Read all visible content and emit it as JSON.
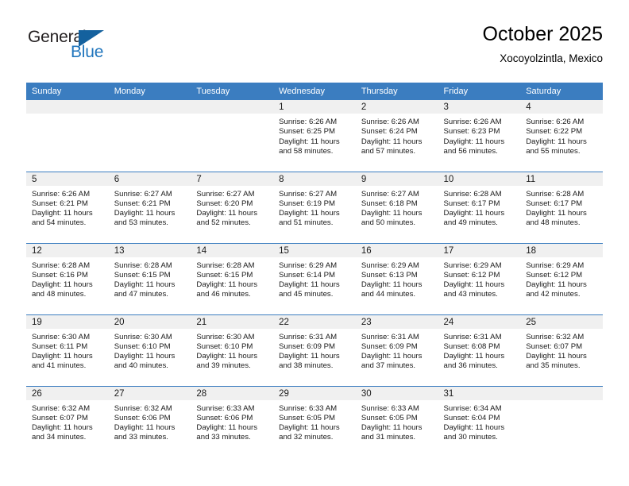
{
  "logo": {
    "word1": "General",
    "word2": "Blue",
    "triangle_color": "#14619e",
    "blue_color": "#2176bd"
  },
  "header": {
    "title": "October 2025",
    "subtitle": "Xocoyolzintla, Mexico"
  },
  "theme": {
    "header_bg": "#3b7dc0",
    "daynum_bg": "#f0f0f0",
    "separator": "#3b7dc0",
    "text": "#1a1a1a"
  },
  "labels": {
    "sunrise_prefix": "Sunrise:",
    "sunset_prefix": "Sunset:",
    "daylight_prefix": "Daylight:"
  },
  "weekdays": [
    "Sunday",
    "Monday",
    "Tuesday",
    "Wednesday",
    "Thursday",
    "Friday",
    "Saturday"
  ],
  "weeks": [
    [
      {
        "day": "",
        "blank": true
      },
      {
        "day": "",
        "blank": true
      },
      {
        "day": "",
        "blank": true
      },
      {
        "day": "1",
        "sunrise": "Sunrise: 6:26 AM",
        "sunset": "Sunset: 6:25 PM",
        "daylight1": "Daylight: 11 hours",
        "daylight2": "and 58 minutes."
      },
      {
        "day": "2",
        "sunrise": "Sunrise: 6:26 AM",
        "sunset": "Sunset: 6:24 PM",
        "daylight1": "Daylight: 11 hours",
        "daylight2": "and 57 minutes."
      },
      {
        "day": "3",
        "sunrise": "Sunrise: 6:26 AM",
        "sunset": "Sunset: 6:23 PM",
        "daylight1": "Daylight: 11 hours",
        "daylight2": "and 56 minutes."
      },
      {
        "day": "4",
        "sunrise": "Sunrise: 6:26 AM",
        "sunset": "Sunset: 6:22 PM",
        "daylight1": "Daylight: 11 hours",
        "daylight2": "and 55 minutes."
      }
    ],
    [
      {
        "day": "5",
        "sunrise": "Sunrise: 6:26 AM",
        "sunset": "Sunset: 6:21 PM",
        "daylight1": "Daylight: 11 hours",
        "daylight2": "and 54 minutes."
      },
      {
        "day": "6",
        "sunrise": "Sunrise: 6:27 AM",
        "sunset": "Sunset: 6:21 PM",
        "daylight1": "Daylight: 11 hours",
        "daylight2": "and 53 minutes."
      },
      {
        "day": "7",
        "sunrise": "Sunrise: 6:27 AM",
        "sunset": "Sunset: 6:20 PM",
        "daylight1": "Daylight: 11 hours",
        "daylight2": "and 52 minutes."
      },
      {
        "day": "8",
        "sunrise": "Sunrise: 6:27 AM",
        "sunset": "Sunset: 6:19 PM",
        "daylight1": "Daylight: 11 hours",
        "daylight2": "and 51 minutes."
      },
      {
        "day": "9",
        "sunrise": "Sunrise: 6:27 AM",
        "sunset": "Sunset: 6:18 PM",
        "daylight1": "Daylight: 11 hours",
        "daylight2": "and 50 minutes."
      },
      {
        "day": "10",
        "sunrise": "Sunrise: 6:28 AM",
        "sunset": "Sunset: 6:17 PM",
        "daylight1": "Daylight: 11 hours",
        "daylight2": "and 49 minutes."
      },
      {
        "day": "11",
        "sunrise": "Sunrise: 6:28 AM",
        "sunset": "Sunset: 6:17 PM",
        "daylight1": "Daylight: 11 hours",
        "daylight2": "and 48 minutes."
      }
    ],
    [
      {
        "day": "12",
        "sunrise": "Sunrise: 6:28 AM",
        "sunset": "Sunset: 6:16 PM",
        "daylight1": "Daylight: 11 hours",
        "daylight2": "and 48 minutes."
      },
      {
        "day": "13",
        "sunrise": "Sunrise: 6:28 AM",
        "sunset": "Sunset: 6:15 PM",
        "daylight1": "Daylight: 11 hours",
        "daylight2": "and 47 minutes."
      },
      {
        "day": "14",
        "sunrise": "Sunrise: 6:28 AM",
        "sunset": "Sunset: 6:15 PM",
        "daylight1": "Daylight: 11 hours",
        "daylight2": "and 46 minutes."
      },
      {
        "day": "15",
        "sunrise": "Sunrise: 6:29 AM",
        "sunset": "Sunset: 6:14 PM",
        "daylight1": "Daylight: 11 hours",
        "daylight2": "and 45 minutes."
      },
      {
        "day": "16",
        "sunrise": "Sunrise: 6:29 AM",
        "sunset": "Sunset: 6:13 PM",
        "daylight1": "Daylight: 11 hours",
        "daylight2": "and 44 minutes."
      },
      {
        "day": "17",
        "sunrise": "Sunrise: 6:29 AM",
        "sunset": "Sunset: 6:12 PM",
        "daylight1": "Daylight: 11 hours",
        "daylight2": "and 43 minutes."
      },
      {
        "day": "18",
        "sunrise": "Sunrise: 6:29 AM",
        "sunset": "Sunset: 6:12 PM",
        "daylight1": "Daylight: 11 hours",
        "daylight2": "and 42 minutes."
      }
    ],
    [
      {
        "day": "19",
        "sunrise": "Sunrise: 6:30 AM",
        "sunset": "Sunset: 6:11 PM",
        "daylight1": "Daylight: 11 hours",
        "daylight2": "and 41 minutes."
      },
      {
        "day": "20",
        "sunrise": "Sunrise: 6:30 AM",
        "sunset": "Sunset: 6:10 PM",
        "daylight1": "Daylight: 11 hours",
        "daylight2": "and 40 minutes."
      },
      {
        "day": "21",
        "sunrise": "Sunrise: 6:30 AM",
        "sunset": "Sunset: 6:10 PM",
        "daylight1": "Daylight: 11 hours",
        "daylight2": "and 39 minutes."
      },
      {
        "day": "22",
        "sunrise": "Sunrise: 6:31 AM",
        "sunset": "Sunset: 6:09 PM",
        "daylight1": "Daylight: 11 hours",
        "daylight2": "and 38 minutes."
      },
      {
        "day": "23",
        "sunrise": "Sunrise: 6:31 AM",
        "sunset": "Sunset: 6:09 PM",
        "daylight1": "Daylight: 11 hours",
        "daylight2": "and 37 minutes."
      },
      {
        "day": "24",
        "sunrise": "Sunrise: 6:31 AM",
        "sunset": "Sunset: 6:08 PM",
        "daylight1": "Daylight: 11 hours",
        "daylight2": "and 36 minutes."
      },
      {
        "day": "25",
        "sunrise": "Sunrise: 6:32 AM",
        "sunset": "Sunset: 6:07 PM",
        "daylight1": "Daylight: 11 hours",
        "daylight2": "and 35 minutes."
      }
    ],
    [
      {
        "day": "26",
        "sunrise": "Sunrise: 6:32 AM",
        "sunset": "Sunset: 6:07 PM",
        "daylight1": "Daylight: 11 hours",
        "daylight2": "and 34 minutes."
      },
      {
        "day": "27",
        "sunrise": "Sunrise: 6:32 AM",
        "sunset": "Sunset: 6:06 PM",
        "daylight1": "Daylight: 11 hours",
        "daylight2": "and 33 minutes."
      },
      {
        "day": "28",
        "sunrise": "Sunrise: 6:33 AM",
        "sunset": "Sunset: 6:06 PM",
        "daylight1": "Daylight: 11 hours",
        "daylight2": "and 33 minutes."
      },
      {
        "day": "29",
        "sunrise": "Sunrise: 6:33 AM",
        "sunset": "Sunset: 6:05 PM",
        "daylight1": "Daylight: 11 hours",
        "daylight2": "and 32 minutes."
      },
      {
        "day": "30",
        "sunrise": "Sunrise: 6:33 AM",
        "sunset": "Sunset: 6:05 PM",
        "daylight1": "Daylight: 11 hours",
        "daylight2": "and 31 minutes."
      },
      {
        "day": "31",
        "sunrise": "Sunrise: 6:34 AM",
        "sunset": "Sunset: 6:04 PM",
        "daylight1": "Daylight: 11 hours",
        "daylight2": "and 30 minutes."
      },
      {
        "day": "",
        "blank": true
      }
    ]
  ]
}
